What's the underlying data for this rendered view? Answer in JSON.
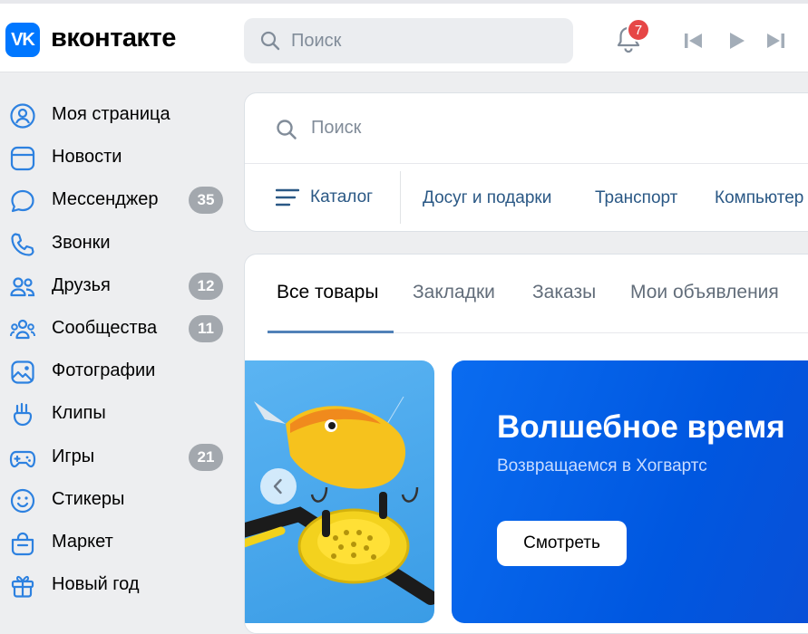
{
  "brand": {
    "logo_glyph": "VK",
    "name": "вконтакте",
    "color": "#0077ff"
  },
  "header": {
    "search_placeholder": "Поиск",
    "notifications_count": "7"
  },
  "sidebar": {
    "items": [
      {
        "label": "Моя страница",
        "icon": "user-circle-icon",
        "count": null
      },
      {
        "label": "Новости",
        "icon": "newsfeed-icon",
        "count": null
      },
      {
        "label": "Мессенджер",
        "icon": "message-icon",
        "count": "35"
      },
      {
        "label": "Звонки",
        "icon": "phone-icon",
        "count": null
      },
      {
        "label": "Друзья",
        "icon": "friends-icon",
        "count": "12"
      },
      {
        "label": "Сообщества",
        "icon": "communities-icon",
        "count": "11"
      },
      {
        "label": "Фотографии",
        "icon": "photo-icon",
        "count": null
      },
      {
        "label": "Клипы",
        "icon": "clips-icon",
        "count": null
      },
      {
        "label": "Игры",
        "icon": "gamepad-icon",
        "count": "21"
      },
      {
        "label": "Стикеры",
        "icon": "smile-icon",
        "count": null
      },
      {
        "label": "Маркет",
        "icon": "bag-icon",
        "count": null
      },
      {
        "label": "Новый год",
        "icon": "gift-icon",
        "count": null
      }
    ]
  },
  "market": {
    "search_placeholder": "Поиск",
    "catalog_label": "Каталог",
    "categories": [
      "Досуг и подарки",
      "Транспорт",
      "Компьютер"
    ],
    "tabs": [
      {
        "label": "Все товары",
        "active": true
      },
      {
        "label": "Закладки",
        "active": false
      },
      {
        "label": "Заказы",
        "active": false
      },
      {
        "label": "Мои объявления",
        "active": false
      }
    ],
    "banner": {
      "title": "Волшебное время",
      "subtitle": "Возвращаемся в Хогвартс",
      "button_label": "Смотреть"
    }
  },
  "colors": {
    "accent": "#0077ff",
    "link": "#2a5885",
    "badge_red": "#e64646",
    "counter_gray": "#a3a8ae",
    "banner_blue": "#0057e0"
  }
}
